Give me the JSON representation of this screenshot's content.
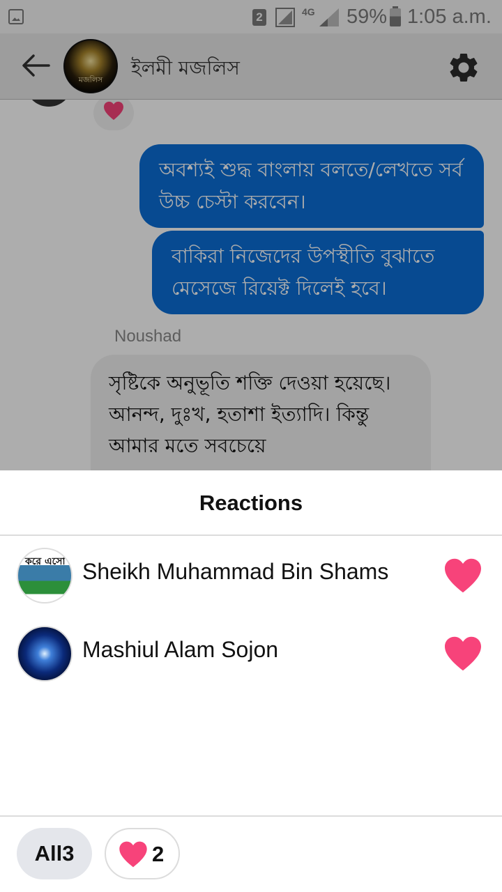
{
  "status_bar": {
    "sim_slot": "2",
    "network": "4G",
    "battery": "59%",
    "time": "1:05 a.m."
  },
  "header": {
    "title": "ইলমী মজলিস",
    "avatar_text": "মজলিস"
  },
  "chat": {
    "outgoing": [
      "অবশ্যই শুদ্ধ বাংলায় বলতে/লেখতে সর্ব উচ্চ চেস্টা করবেন।",
      "বাকিরা নিজেদের উপস্থীতি বুঝাতে মেসেজে রিয়েক্ট দিলেই হবে।"
    ],
    "incoming_sender": "Noushad",
    "incoming_text": "সৃষ্টিকে অনুভূতি শক্তি দেওয়া হয়েছে। আনন্দ, দুঃখ, হতাশা ইত্যাদি। কিন্তু আমার মতে সবচেয়ে"
  },
  "sheet": {
    "title": "Reactions",
    "reactors": [
      {
        "name": "Sheikh Muhammad Bin Shams",
        "avatar_text": "করে এসো",
        "reaction": "heart"
      },
      {
        "name": "Mashiul Alam Sojon",
        "reaction": "heart"
      }
    ],
    "filters": {
      "all_label": "All",
      "all_count": "3",
      "heart_count": "2"
    }
  },
  "colors": {
    "accent": "#0b6dd6",
    "heart": "#f7437a"
  }
}
